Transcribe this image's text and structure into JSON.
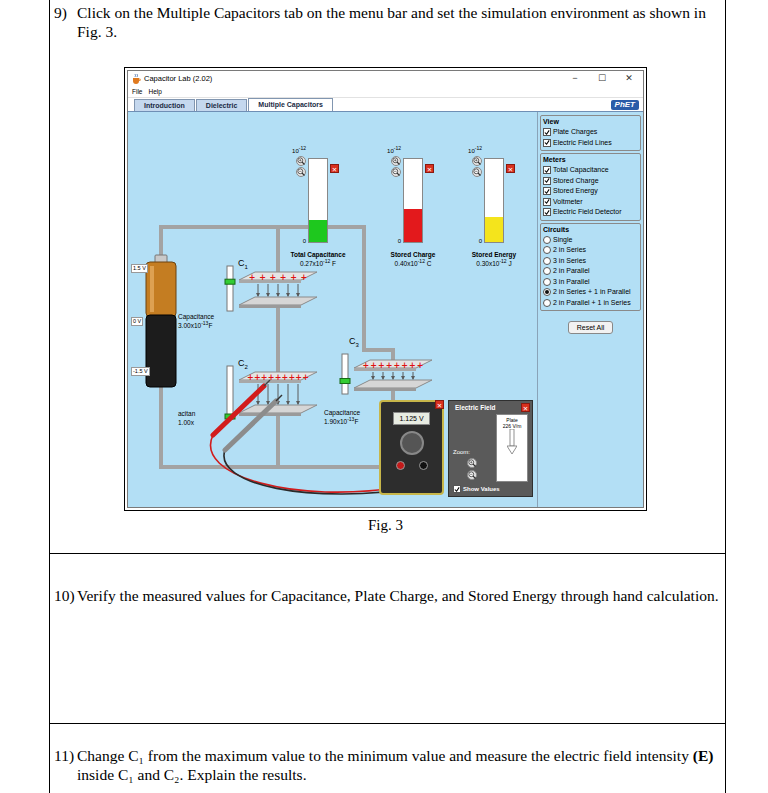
{
  "document": {
    "items": [
      {
        "number": "9)",
        "runs": [
          {
            "text": "Click on the Multiple Capacitors tab on the menu bar and set the simulation environment as shown in Fig. 3.",
            "bold": false
          }
        ]
      },
      {
        "number": "10)",
        "runs": [
          {
            "text": "Verify the measured values for Capacitance, Plate Charge, and Stored Energy through hand calculation.",
            "bold": false
          }
        ]
      },
      {
        "number": "11)",
        "runs": [
          {
            "text": "Change C₁ from the maximum value to the minimum value and measure the electric field intensity ",
            "bold": false
          },
          {
            "text": "(E)",
            "bold": true
          },
          {
            "text": " inside C₁ and C₂. Explain the results.",
            "bold": false
          }
        ]
      }
    ],
    "figure_caption": "Fig. 3"
  },
  "app": {
    "window": {
      "title": "Capacitor Lab (2.02)",
      "controls": [
        "−",
        "☐",
        "✕"
      ]
    },
    "menu": [
      "File",
      "Help"
    ],
    "tabs": [
      {
        "label": "Introduction",
        "selected": false
      },
      {
        "label": "Dielectric",
        "selected": false
      },
      {
        "label": "Multiple Capacitors",
        "selected": true
      }
    ],
    "logo": "PhET",
    "battery": {
      "labels": [
        "1.5 V",
        "0 V",
        "-1.5 V"
      ]
    },
    "meters": [
      {
        "title": "Total Capacitance",
        "scale": "10",
        "scale_exp": "-12",
        "zero": "0",
        "level": 0.27,
        "color": "#1ec81e",
        "value": "0.27x10",
        "value_exp": "-12",
        "unit": "F",
        "close": "✕"
      },
      {
        "title": "Stored Charge",
        "scale": "10",
        "scale_exp": "-12",
        "zero": "0",
        "level": 0.4,
        "color": "#e3191c",
        "value": "0.40x10",
        "value_exp": "-12",
        "unit": "C",
        "close": "✕"
      },
      {
        "title": "Stored Energy",
        "scale": "10",
        "scale_exp": "-12",
        "zero": "0",
        "level": 0.3,
        "color": "#f4e41c",
        "value": "0.30x10",
        "value_exp": "-12",
        "unit": "J",
        "close": "✕"
      }
    ],
    "capacitors": [
      {
        "symbol": "C",
        "subscript": "1",
        "slider_level": 0.67,
        "charges": 6,
        "label": "Capacitance",
        "value": "3.00x10",
        "value_exp": "-13",
        "unit": "F"
      },
      {
        "symbol": "C",
        "subscript": "2",
        "slider_level": 0.0,
        "charges": 9,
        "label": "acitan",
        "value": "1.00x",
        "value_exp": "",
        "unit": ""
      },
      {
        "symbol": "C",
        "subscript": "3",
        "slider_level": 0.3,
        "charges": 8,
        "label": "Capacitance",
        "value": "1.90x10",
        "value_exp": "-13",
        "unit": "F"
      }
    ],
    "plus_sign": "+",
    "voltmeter": {
      "reading": "1.125 V",
      "close": "✕"
    },
    "field_detector": {
      "title": "Electric Field",
      "close": "✕",
      "plate_label": "Plate",
      "reading": "226 V/m",
      "zoom_label": "Zoom:",
      "show_values": {
        "label": "Show Values",
        "checked": true
      }
    },
    "panel": {
      "groups": [
        {
          "title": "View",
          "kind": "checkbox",
          "items": [
            {
              "label": "Plate Charges",
              "checked": true,
              "selected": false
            },
            {
              "label": "Electric Field Lines",
              "checked": true,
              "selected": false
            }
          ]
        },
        {
          "title": "Meters",
          "kind": "checkbox",
          "items": [
            {
              "label": "Total Capacitance",
              "checked": true,
              "selected": false
            },
            {
              "label": "Stored Charge",
              "checked": true,
              "selected": false
            },
            {
              "label": "Stored Energy",
              "checked": true,
              "selected": false
            },
            {
              "label": "Voltmeter",
              "checked": true,
              "selected": false
            },
            {
              "label": "Electric Field Detector",
              "checked": true,
              "selected": false
            }
          ]
        },
        {
          "title": "Circuits",
          "kind": "radio",
          "items": [
            {
              "label": "Single",
              "checked": false,
              "selected": false
            },
            {
              "label": "2 in Series",
              "checked": false,
              "selected": false
            },
            {
              "label": "3 in Series",
              "checked": false,
              "selected": false
            },
            {
              "label": "2 in Parallel",
              "checked": false,
              "selected": false
            },
            {
              "label": "3 in Parallel",
              "checked": false,
              "selected": false
            },
            {
              "label": "2 in Series + 1 in Parallel",
              "checked": false,
              "selected": true
            },
            {
              "label": "2 in Parallel + 1 in Series",
              "checked": false,
              "selected": false
            }
          ]
        }
      ],
      "reset": "Reset All"
    }
  }
}
